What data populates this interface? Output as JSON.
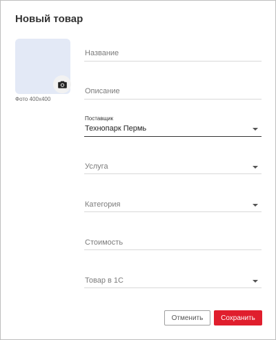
{
  "dialog": {
    "title": "Новый товар"
  },
  "photo": {
    "caption": "Фото 400x400",
    "camera_icon": "camera-icon"
  },
  "fields": {
    "name": {
      "placeholder": "Название"
    },
    "description": {
      "placeholder": "Описание"
    },
    "supplier": {
      "label": "Поставщик",
      "value": "Технопарк Пермь"
    },
    "service": {
      "placeholder": "Услуга"
    },
    "category": {
      "placeholder": "Категория"
    },
    "price": {
      "placeholder": "Стоимость"
    },
    "product_1c": {
      "placeholder": "Товар в 1С"
    }
  },
  "buttons": {
    "cancel_label": "Отменить",
    "save_label": "Сохранить"
  },
  "colors": {
    "accent": "#e01e2d",
    "photo_bg": "#e3e9f6"
  }
}
